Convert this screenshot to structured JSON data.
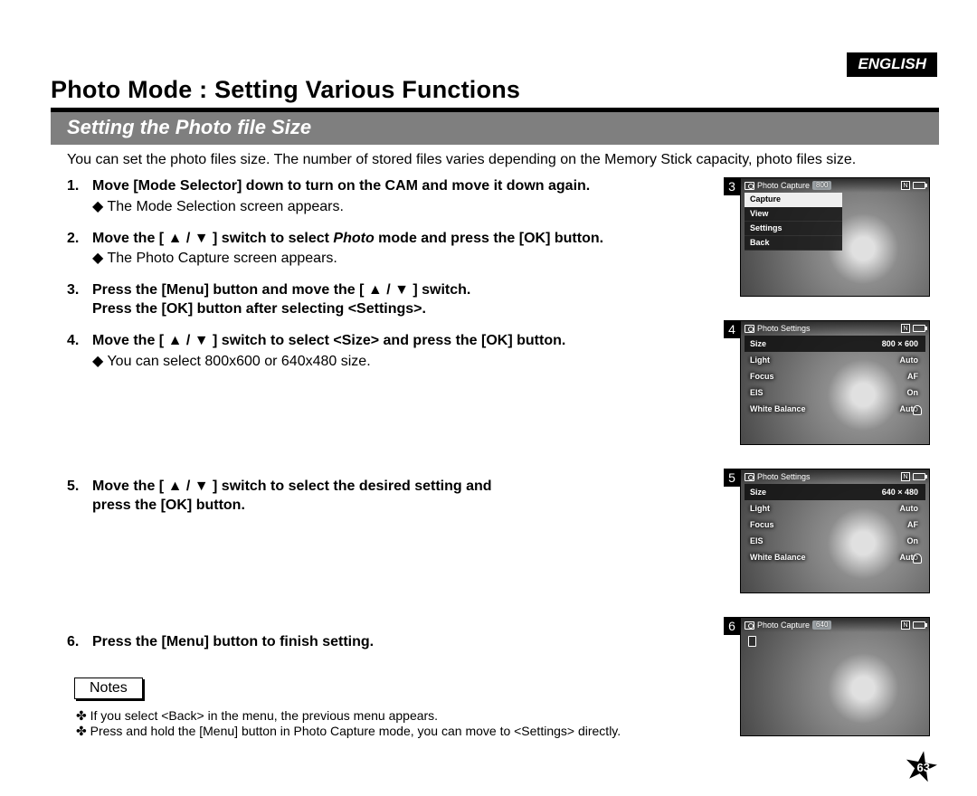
{
  "language_badge": "ENGLISH",
  "main_title": "Photo Mode : Setting Various Functions",
  "section_title": "Setting the Photo file Size",
  "intro": "You can set the photo files size. The number of stored files varies depending on the Memory Stick capacity, photo files size.",
  "steps": [
    {
      "main": "Move [Mode Selector] down to turn on the CAM and move it down again.",
      "sub": "The Mode Selection screen appears."
    },
    {
      "main_pre": "Move the [ ▲ / ▼ ] switch to select ",
      "main_italic": "Photo",
      "main_post": " mode and press the [OK] button.",
      "sub": "The Photo Capture screen appears."
    },
    {
      "main_line1": "Press the [Menu] button and move the [ ▲ / ▼ ] switch.",
      "main_line2": "Press the [OK] button after selecting <Settings>."
    },
    {
      "main": "Move the [ ▲ / ▼ ] switch to select <Size> and press the [OK] button.",
      "sub": "You can select 800x600 or 640x480 size."
    },
    {
      "main_line1": "Move the [ ▲ / ▼ ] switch to select the desired setting and",
      "main_line2": "press the [OK] button."
    },
    {
      "main": "Press the [Menu] button to finish setting."
    }
  ],
  "notes_label": "Notes",
  "notes": [
    "If you select <Back> in the menu, the previous menu appears.",
    "Press and hold the [Menu] button in Photo Capture mode, you can move to <Settings> directly."
  ],
  "figures": {
    "fig3": {
      "num": "3",
      "title": "Photo Capture",
      "badge": "800",
      "menu": [
        "Capture",
        "View",
        "Settings",
        "Back"
      ],
      "active": 0
    },
    "fig4": {
      "num": "4",
      "title": "Photo Settings",
      "rows": [
        {
          "k": "Size",
          "v": "800 × 600"
        },
        {
          "k": "Light",
          "v": "Auto"
        },
        {
          "k": "Focus",
          "v": "AF"
        },
        {
          "k": "EIS",
          "v": "On"
        },
        {
          "k": "White Balance",
          "v": "Auto"
        }
      ],
      "active": 0
    },
    "fig5": {
      "num": "5",
      "title": "Photo Settings",
      "rows": [
        {
          "k": "Size",
          "v": "640 × 480"
        },
        {
          "k": "Light",
          "v": "Auto"
        },
        {
          "k": "Focus",
          "v": "AF"
        },
        {
          "k": "EIS",
          "v": "On"
        },
        {
          "k": "White Balance",
          "v": "Auto"
        }
      ],
      "active": 0
    },
    "fig6": {
      "num": "6",
      "title": "Photo Capture",
      "badge": "640"
    }
  },
  "page_number": "63"
}
